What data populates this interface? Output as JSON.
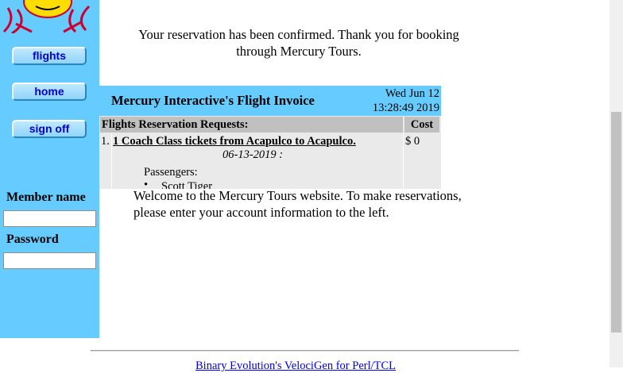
{
  "sidebar": {
    "nav": {
      "flights": "flights",
      "home": "home",
      "sign_off": "sign off"
    },
    "login": {
      "member_name_label": "Member name",
      "member_name_value": "",
      "password_label": "Password",
      "password_value": ""
    }
  },
  "confirmation": {
    "message": "Your reservation has been confirmed. Thank you for booking through Mercury Tours."
  },
  "invoice": {
    "title": "Mercury Interactive's Flight Invoice",
    "date_line1": "Wed Jun 12",
    "date_line2": "13:28:49 2019",
    "header_requests": "Flights Reservation Requests:",
    "header_cost": "Cost",
    "row_number": "1.",
    "row_link": "1 Coach Class tickets from Acapulco to Acapulco.",
    "row_date": "06-13-2019 :",
    "row_cost": "$ 0",
    "passengers_label": "Passengers:",
    "passenger_bullet": "•",
    "passenger_name": "Scott Tiger"
  },
  "welcome": {
    "message": "Welcome to the Mercury Tours website. To make reservations, please enter your account information to the left."
  },
  "footer": {
    "link": "Binary Evolution's VelociGen for Perl/TCL"
  },
  "colors": {
    "sidebar_bg": "#66ccff",
    "invoice_header_bg": "#66ccff",
    "table_header_bg": "#c0c0c0",
    "table_body_bg": "#eaeaea",
    "link": "#0000ee"
  }
}
